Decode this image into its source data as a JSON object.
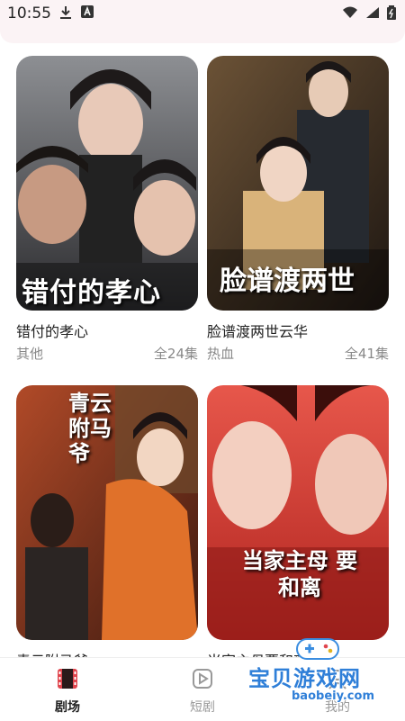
{
  "status": {
    "time": "10:55"
  },
  "cards": [
    {
      "title": "错付的孝心",
      "overlay": "错付的孝心",
      "genre": "其他",
      "episodes": "全24集"
    },
    {
      "title": "脸谱渡两世云华",
      "overlay": "脸谱渡两世",
      "genre": "热血",
      "episodes": "全41集"
    },
    {
      "title": "青云附马爷",
      "overlay": "青云附马爷",
      "genre": "",
      "episodes": ""
    },
    {
      "title": "当家主母要和离",
      "overlay": "当家主母 要和离",
      "genre": "",
      "episodes": ""
    }
  ],
  "tabs": [
    {
      "label": "剧场",
      "icon": "film-icon",
      "active": true
    },
    {
      "label": "短剧",
      "icon": "play-icon",
      "active": false
    },
    {
      "label": "我的",
      "icon": "user-icon",
      "active": false
    }
  ],
  "watermark": {
    "name": "宝贝游戏网",
    "url": "baobeiy.com"
  },
  "colors": {
    "accent": "#e0464e",
    "muted": "#888888"
  }
}
